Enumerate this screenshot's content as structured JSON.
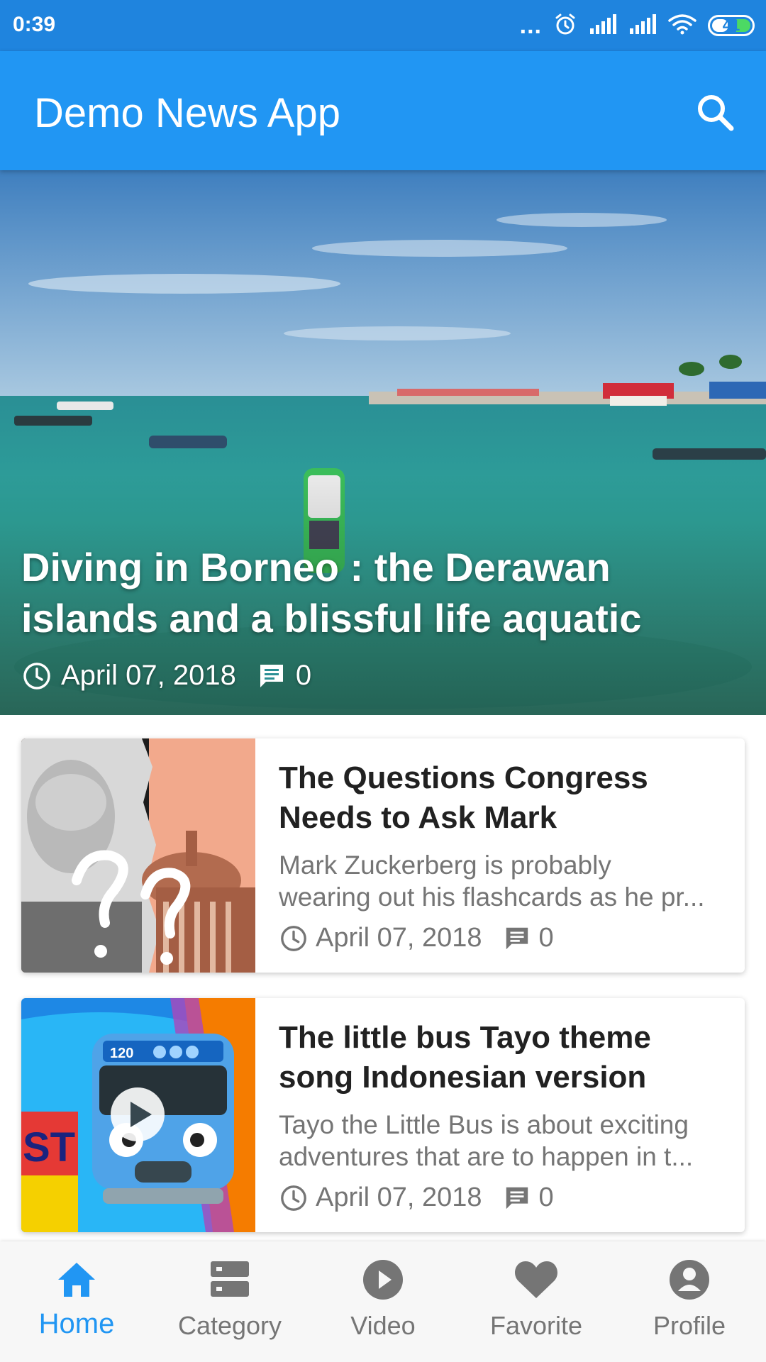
{
  "status_bar": {
    "time": "0:39",
    "dots": "...",
    "battery": "41",
    "icons": [
      "alarm-icon",
      "signal-icon",
      "signal-icon",
      "wifi-icon",
      "battery-icon"
    ]
  },
  "app_bar": {
    "title": "Demo News App",
    "search_icon": "search-icon",
    "background": "#2196f3"
  },
  "hero": {
    "title": "Diving in Borneo : the Derawan islands and a blissful life aquatic",
    "date": "April 07, 2018",
    "comments": "0"
  },
  "articles": [
    {
      "title": "The Questions Congress Needs to Ask Mark",
      "excerpt_line1": "Mark Zuckerberg is probably",
      "excerpt_line2": "wearing out his flashcards as he pr...",
      "date": "April 07, 2018",
      "comments": "0"
    },
    {
      "title": "The little bus Tayo theme song Indonesian version",
      "excerpt_line1": "Tayo the Little Bus is about exciting",
      "excerpt_line2": "adventures that are to happen in t...",
      "date": "April 07, 2018",
      "comments": "0",
      "thumb_text_bus_number": "120",
      "thumb_text_side": "ST"
    }
  ],
  "bottom_nav": {
    "active": "Home",
    "active_color": "#2196f3",
    "items": [
      {
        "label": "Home",
        "icon": "home-icon"
      },
      {
        "label": "Category",
        "icon": "category-icon"
      },
      {
        "label": "Video",
        "icon": "video-icon"
      },
      {
        "label": "Favorite",
        "icon": "heart-icon"
      },
      {
        "label": "Profile",
        "icon": "profile-icon"
      }
    ]
  }
}
